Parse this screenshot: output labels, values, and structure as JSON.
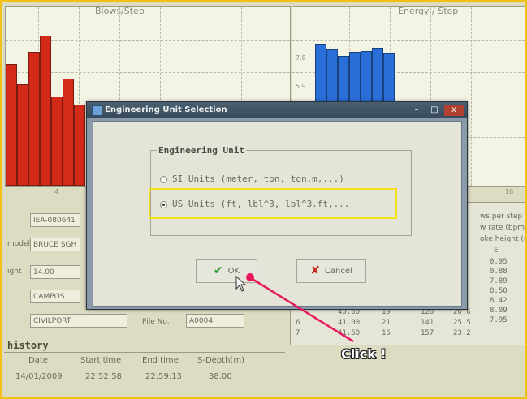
{
  "charts": {
    "blows": {
      "title": "Blows/Step",
      "tick": "4"
    },
    "energy": {
      "title": "Energy / Step",
      "ticks": [
        "7.8",
        "5.9"
      ],
      "xtick": "16"
    }
  },
  "left_panel": {
    "field_1": "IEA-080641",
    "model_label": "model",
    "model_value": "BRUCE SGH",
    "weight_label": "ight",
    "weight_value": "14.00",
    "field_4": "CAMPOS",
    "field_5": "CIVILPORT",
    "pile_label": "Pile No.",
    "pile_value": "A0004"
  },
  "right_panel": {
    "legend_1": "ws per step",
    "legend_2": "w rate (bpm)",
    "legend_3": "oke height (m)",
    "col_header": "E",
    "e_values": [
      "0.95",
      "0.88",
      "7.89",
      "8.50",
      "8.42",
      "8.09",
      "7.95"
    ],
    "rows": [
      {
        "n": "",
        "a": "40.50",
        "b": "19",
        "c": "120",
        "d": "26.6"
      },
      {
        "n": "6",
        "a": "41.00",
        "b": "21",
        "c": "141",
        "d": "25.5"
      },
      {
        "n": "7",
        "a": "41.50",
        "b": "16",
        "c": "157",
        "d": "23.2"
      }
    ]
  },
  "history": {
    "title": "history",
    "headers": [
      "Date",
      "Start time",
      "End time",
      "S-Depth(m)"
    ],
    "row": [
      "14/01/2009",
      "22:52:58",
      "22:59:13",
      "38.00"
    ]
  },
  "dialog": {
    "title": "Engineering Unit Selection",
    "group_label": "Engineering Unit",
    "option_si": "SI Units (meter, ton, ton.m,...)",
    "option_us": "US Units (ft, lbl^3, lbl^3.ft,...",
    "selected": "us",
    "ok_label": "OK",
    "cancel_label": "Cancel",
    "winbtn_min": "–",
    "winbtn_max": "□",
    "winbtn_close": "x"
  },
  "annotation": {
    "text": "Click !",
    "color": "#e8185f",
    "highlight_color": "#f2e21a"
  },
  "colors": {
    "frame": "#f1c215",
    "bar_red": "#d32a1a",
    "bar_blue": "#2a6fd8"
  }
}
